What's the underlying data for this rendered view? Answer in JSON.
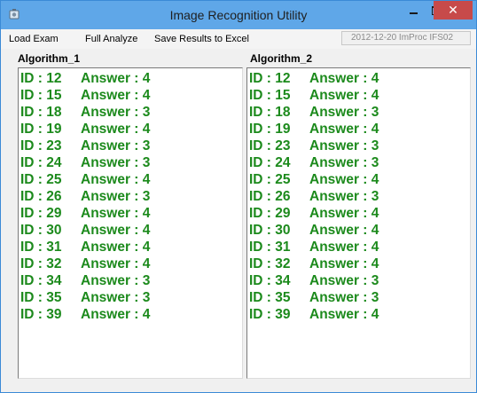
{
  "window": {
    "title": "Image Recognition Utility",
    "close_symbol": "✕",
    "icons": [
      "app-icon",
      "minimize-icon",
      "maximize-icon",
      "close-icon"
    ]
  },
  "menu": {
    "items": [
      "Load Exam",
      "Full Analyze",
      "Save Results to Excel"
    ],
    "status_text": "2012-12-20 ImProc IFS02"
  },
  "colors": {
    "titlebar": "#5fa7e8",
    "close_button": "#c74a4a",
    "result_text": "#1c8a1c"
  },
  "panels": [
    {
      "label": "Algorithm_1",
      "rows": [
        {
          "id": "ID : 12",
          "answer": "Answer : 4"
        },
        {
          "id": "ID : 15",
          "answer": "Answer : 4"
        },
        {
          "id": "ID : 18",
          "answer": "Answer : 3"
        },
        {
          "id": "ID : 19",
          "answer": "Answer : 4"
        },
        {
          "id": "ID : 23",
          "answer": "Answer : 3"
        },
        {
          "id": "ID : 24",
          "answer": "Answer : 3"
        },
        {
          "id": "ID : 25",
          "answer": "Answer : 4"
        },
        {
          "id": "ID : 26",
          "answer": "Answer : 3"
        },
        {
          "id": "ID : 29",
          "answer": "Answer : 4"
        },
        {
          "id": "ID : 30",
          "answer": "Answer : 4"
        },
        {
          "id": "ID : 31",
          "answer": "Answer : 4"
        },
        {
          "id": "ID : 32",
          "answer": "Answer : 4"
        },
        {
          "id": "ID : 34",
          "answer": "Answer : 3"
        },
        {
          "id": "ID : 35",
          "answer": "Answer : 3"
        },
        {
          "id": "ID : 39",
          "answer": "Answer : 4"
        }
      ]
    },
    {
      "label": "Algorithm_2",
      "rows": [
        {
          "id": "ID : 12",
          "answer": "Answer : 4"
        },
        {
          "id": "ID : 15",
          "answer": "Answer : 4"
        },
        {
          "id": "ID : 18",
          "answer": "Answer : 3"
        },
        {
          "id": "ID : 19",
          "answer": "Answer : 4"
        },
        {
          "id": "ID : 23",
          "answer": "Answer : 3"
        },
        {
          "id": "ID : 24",
          "answer": "Answer : 3"
        },
        {
          "id": "ID : 25",
          "answer": "Answer : 4"
        },
        {
          "id": "ID : 26",
          "answer": "Answer : 3"
        },
        {
          "id": "ID : 29",
          "answer": "Answer : 4"
        },
        {
          "id": "ID : 30",
          "answer": "Answer : 4"
        },
        {
          "id": "ID : 31",
          "answer": "Answer : 4"
        },
        {
          "id": "ID : 32",
          "answer": "Answer : 4"
        },
        {
          "id": "ID : 34",
          "answer": "Answer : 3"
        },
        {
          "id": "ID : 35",
          "answer": "Answer : 3"
        },
        {
          "id": "ID : 39",
          "answer": "Answer : 4"
        }
      ]
    }
  ]
}
